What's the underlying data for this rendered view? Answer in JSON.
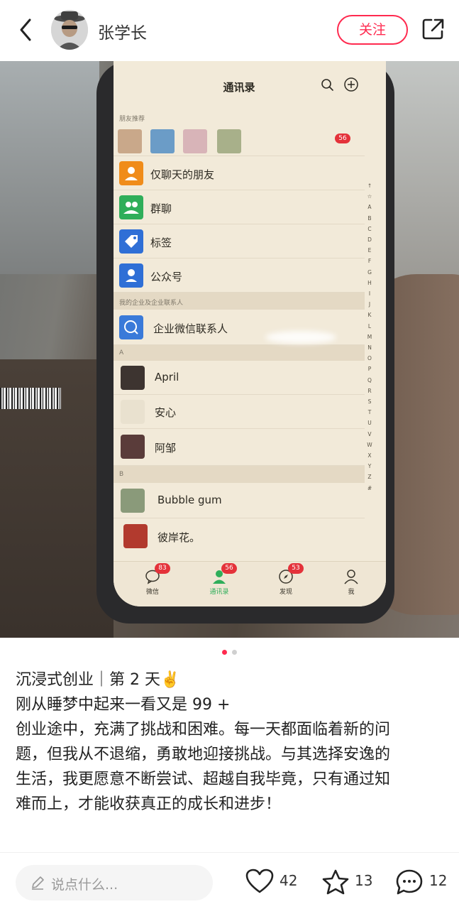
{
  "header": {
    "author_name": "张学长",
    "follow_label": "关注",
    "back_icon": "chevron-left-icon",
    "share_icon": "share-out-icon"
  },
  "photo": {
    "screen": {
      "title": "通讯录",
      "rec_label": "朋友推荐",
      "rec_badge": "56",
      "rows": [
        {
          "label": "仅聊天的朋友",
          "icon": "person-chat-icon",
          "color": "#f08c1a"
        },
        {
          "label": "群聊",
          "icon": "group-icon",
          "color": "#2fae5a"
        },
        {
          "label": "标签",
          "icon": "tag-icon",
          "color": "#2f6fd6"
        },
        {
          "label": "公众号",
          "icon": "official-account-icon",
          "color": "#2f6fd6"
        }
      ],
      "enterprise_label": "我的企业及企业联系人",
      "enterprise_row": "企业微信联系人",
      "section_a": "A",
      "contacts_a": [
        "April",
        "安心",
        "阿邹"
      ],
      "section_b": "B",
      "contacts_b": [
        "Bubble gum",
        "彼岸花。"
      ],
      "alphabet": "↑ ☆ A B C D E F G H I J K L M N O P Q R S T U V W X Y Z #",
      "tabs": [
        {
          "label": "微信",
          "badge": "83"
        },
        {
          "label": "通讯录",
          "badge": "56"
        },
        {
          "label": "发现",
          "badge": "53"
        },
        {
          "label": "我",
          "badge": ""
        }
      ]
    }
  },
  "carousel": {
    "count": 2,
    "active": 0
  },
  "post": {
    "title": "沉浸式创业｜第 2 天✌️",
    "lines": [
      "刚从睡梦中起来一看又是 99 +",
      "创业途中，充满了挑战和困难。每一天都面临着新的问",
      "题，但我从不退缩，勇敢地迎接挑战。与其选择安逸的",
      "生活，我更愿意不断尝试、超越自我毕竟，只有通过知",
      "难而上，才能收获真正的成长和进步！"
    ]
  },
  "bottom": {
    "comment_placeholder": "说点什么...",
    "likes": "42",
    "stars": "13",
    "comments": "12"
  },
  "colors": {
    "accent": "#ff2a4f",
    "wechat_green": "#2fae5a"
  }
}
